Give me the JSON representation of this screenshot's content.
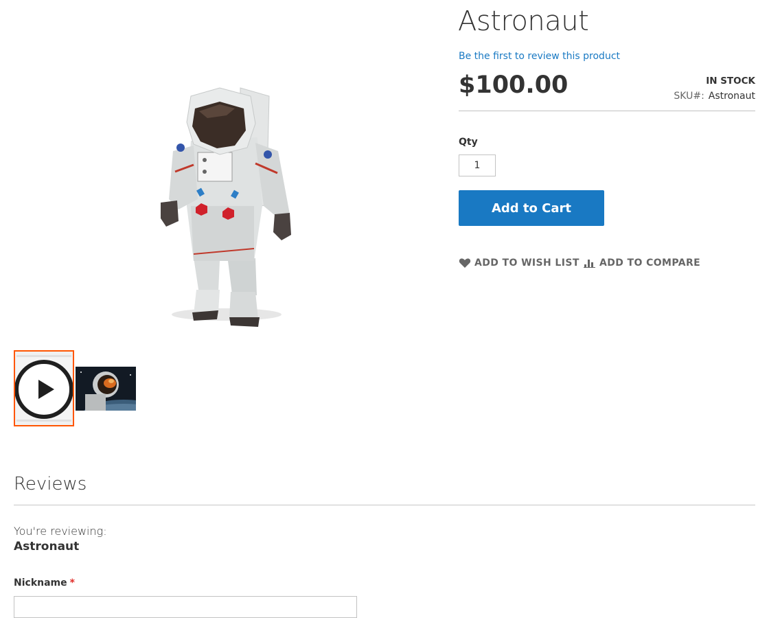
{
  "product": {
    "title": "Astronaut",
    "review_link": "Be the first to review this product",
    "price": "$100.00",
    "stock_status": "IN STOCK",
    "sku_label": "SKU#:",
    "sku_value": "Astronaut"
  },
  "purchase": {
    "qty_label": "Qty",
    "qty_value": "1",
    "add_to_cart": "Add to Cart"
  },
  "actions": {
    "wish_list": "ADD TO WISH LIST",
    "compare": "ADD TO COMPARE"
  },
  "gallery": {
    "thumbnails": [
      {
        "type": "video",
        "icon": "play-icon",
        "selected": true
      },
      {
        "type": "image",
        "depicts": "astronaut-in-space"
      }
    ]
  },
  "reviews": {
    "title": "Reviews",
    "reviewing_label": "You're reviewing:",
    "reviewing_product": "Astronaut",
    "nickname_label": "Nickname",
    "required_mark": "*",
    "nickname_value": ""
  },
  "colors": {
    "accent": "#1979c3",
    "selected_thumb_border": "#ff5501",
    "required": "#e02b27"
  }
}
